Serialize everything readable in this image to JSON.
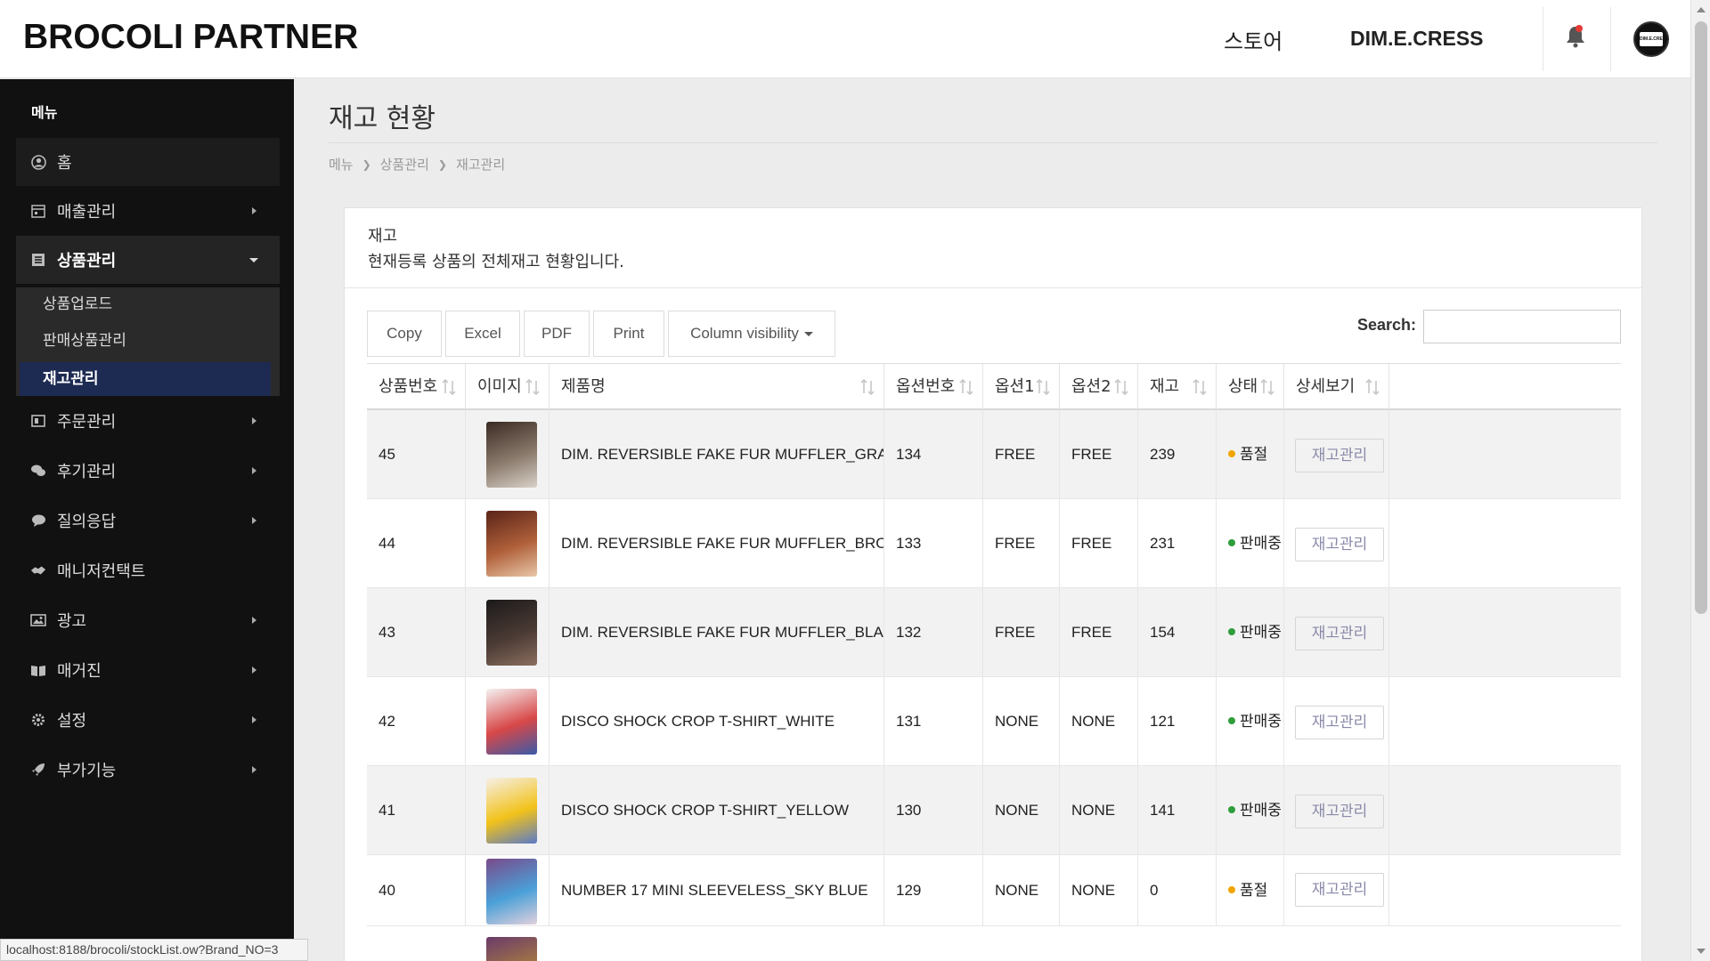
{
  "header": {
    "logo": "BROCOLI PARTNER",
    "store_link": "스토어",
    "brand_name": "DIM.E.CRESS",
    "notification_icon": "bell-icon",
    "avatar_text": "DIM.E.CRESS"
  },
  "sidebar": {
    "title": "메뉴",
    "items": [
      {
        "label": "홈",
        "icon": "user-circle-icon"
      },
      {
        "label": "매출관리",
        "icon": "calendar-icon"
      },
      {
        "label": "상품관리",
        "icon": "list-icon"
      },
      {
        "label": "주문관리",
        "icon": "columns-icon"
      },
      {
        "label": "후기관리",
        "icon": "chat-bubbles-icon"
      },
      {
        "label": "질의응답",
        "icon": "speech-bubble-icon"
      },
      {
        "label": "매니저컨택트",
        "icon": "handshake-icon"
      },
      {
        "label": "광고",
        "icon": "image-icon"
      },
      {
        "label": "매거진",
        "icon": "book-icon"
      },
      {
        "label": "설정",
        "icon": "gear-icon"
      },
      {
        "label": "부가기능",
        "icon": "rocket-icon"
      }
    ],
    "submenu": [
      {
        "label": "상품업로드"
      },
      {
        "label": "판매상품관리"
      },
      {
        "label": "재고관리"
      }
    ]
  },
  "page": {
    "title": "재고 현황",
    "breadcrumb": [
      "메뉴",
      "상품관리",
      "재고관리"
    ]
  },
  "card": {
    "title": "재고",
    "description": "현재등록 상품의 전체재고 현황입니다."
  },
  "toolbar": {
    "buttons": [
      "Copy",
      "Excel",
      "PDF",
      "Print",
      "Column visibility"
    ],
    "search_label": "Search:",
    "search_value": ""
  },
  "table": {
    "columns": [
      "상품번호",
      "이미지",
      "제품명",
      "옵션번호",
      "옵션1",
      "옵션2",
      "재고",
      "상태",
      "상세보기"
    ],
    "rows": [
      {
        "id": "45",
        "name": "DIM. REVERSIBLE FAKE FUR MUFFLER_GRAY",
        "option_no": "134",
        "opt1": "FREE",
        "opt2": "FREE",
        "stock": "239",
        "status": "품절",
        "status_color": "#f0a500",
        "action": "재고관리"
      },
      {
        "id": "44",
        "name": "DIM. REVERSIBLE FAKE FUR MUFFLER_BROWN",
        "option_no": "133",
        "opt1": "FREE",
        "opt2": "FREE",
        "stock": "231",
        "status": "판매중",
        "status_color": "#2e9d3a",
        "action": "재고관리"
      },
      {
        "id": "43",
        "name": "DIM. REVERSIBLE FAKE FUR MUFFLER_BLACK",
        "option_no": "132",
        "opt1": "FREE",
        "opt2": "FREE",
        "stock": "154",
        "status": "판매중",
        "status_color": "#2e9d3a",
        "action": "재고관리"
      },
      {
        "id": "42",
        "name": "DISCO SHOCK CROP T-SHIRT_WHITE",
        "option_no": "131",
        "opt1": "NONE",
        "opt2": "NONE",
        "stock": "121",
        "status": "판매중",
        "status_color": "#2e9d3a",
        "action": "재고관리"
      },
      {
        "id": "41",
        "name": "DISCO SHOCK CROP T-SHIRT_YELLOW",
        "option_no": "130",
        "opt1": "NONE",
        "opt2": "NONE",
        "stock": "141",
        "status": "판매중",
        "status_color": "#2e9d3a",
        "action": "재고관리"
      },
      {
        "id": "40",
        "name": "NUMBER 17 MINI SLEEVELESS_SKY BLUE",
        "option_no": "129",
        "opt1": "NONE",
        "opt2": "NONE",
        "stock": "0",
        "status": "품절",
        "status_color": "#f0a500",
        "action": "재고관리"
      }
    ]
  },
  "status_bar": {
    "url": "localhost:8188/brocoli/stockList.ow?Brand_NO=3"
  }
}
